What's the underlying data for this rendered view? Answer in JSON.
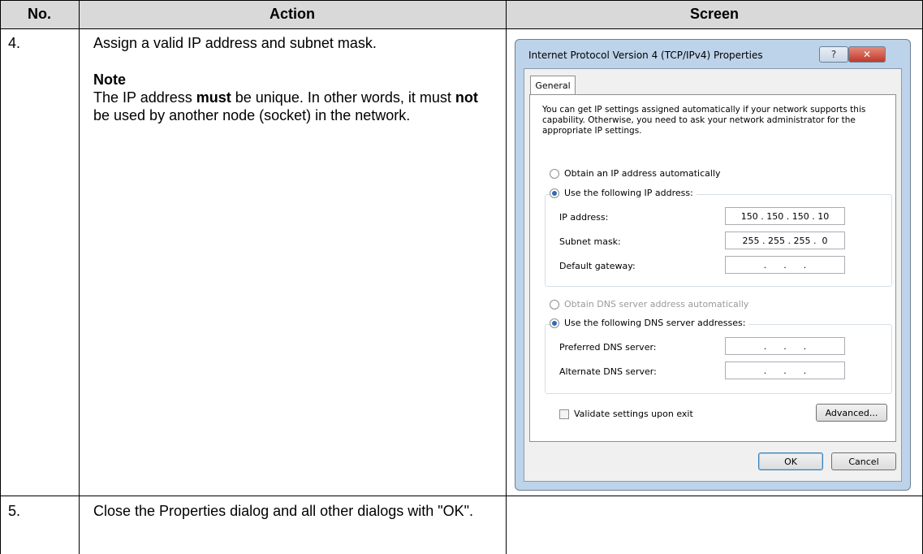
{
  "table": {
    "headers": [
      "No.",
      "Action",
      "Screen"
    ],
    "rows": [
      {
        "no": "4.",
        "action": "Assign a valid IP address and subnet mask.",
        "note_heading": "Note",
        "note_parts": [
          "The IP address ",
          "must",
          " be unique. In other words, it must ",
          "not",
          " be used by another node (socket) in the network."
        ]
      },
      {
        "no": "5.",
        "action": "Close the Properties dialog and all other dialogs with \"OK\"."
      }
    ]
  },
  "dialog": {
    "title": "Internet Protocol Version 4 (TCP/IPv4) Properties",
    "help_glyph": "?",
    "close_glyph": "✕",
    "tab": "General",
    "description": "You can get IP settings assigned automatically if your network supports this capability. Otherwise, you need to ask your network administrator for the appropriate IP settings.",
    "ip_auto_label": "Obtain an IP address automatically",
    "ip_manual_label": "Use the following IP address:",
    "ip_address_label": "IP address:",
    "ip_address_value": "150 . 150 . 150 . 10",
    "subnet_label": "Subnet mask:",
    "subnet_value": "255 . 255 . 255 .  0",
    "gateway_label": "Default gateway:",
    "gateway_value": ".      .      .",
    "dns_auto_label": "Obtain DNS server address automatically",
    "dns_manual_label": "Use the following DNS server addresses:",
    "preferred_dns_label": "Preferred DNS server:",
    "preferred_dns_value": ".      .      .",
    "alternate_dns_label": "Alternate DNS server:",
    "alternate_dns_value": ".      .      .",
    "validate_label": "Validate settings upon exit",
    "advanced_label": "Advanced...",
    "ok_label": "OK",
    "cancel_label": "Cancel",
    "ip_mode": "manual",
    "dns_mode": "manual",
    "validate_checked": false
  }
}
